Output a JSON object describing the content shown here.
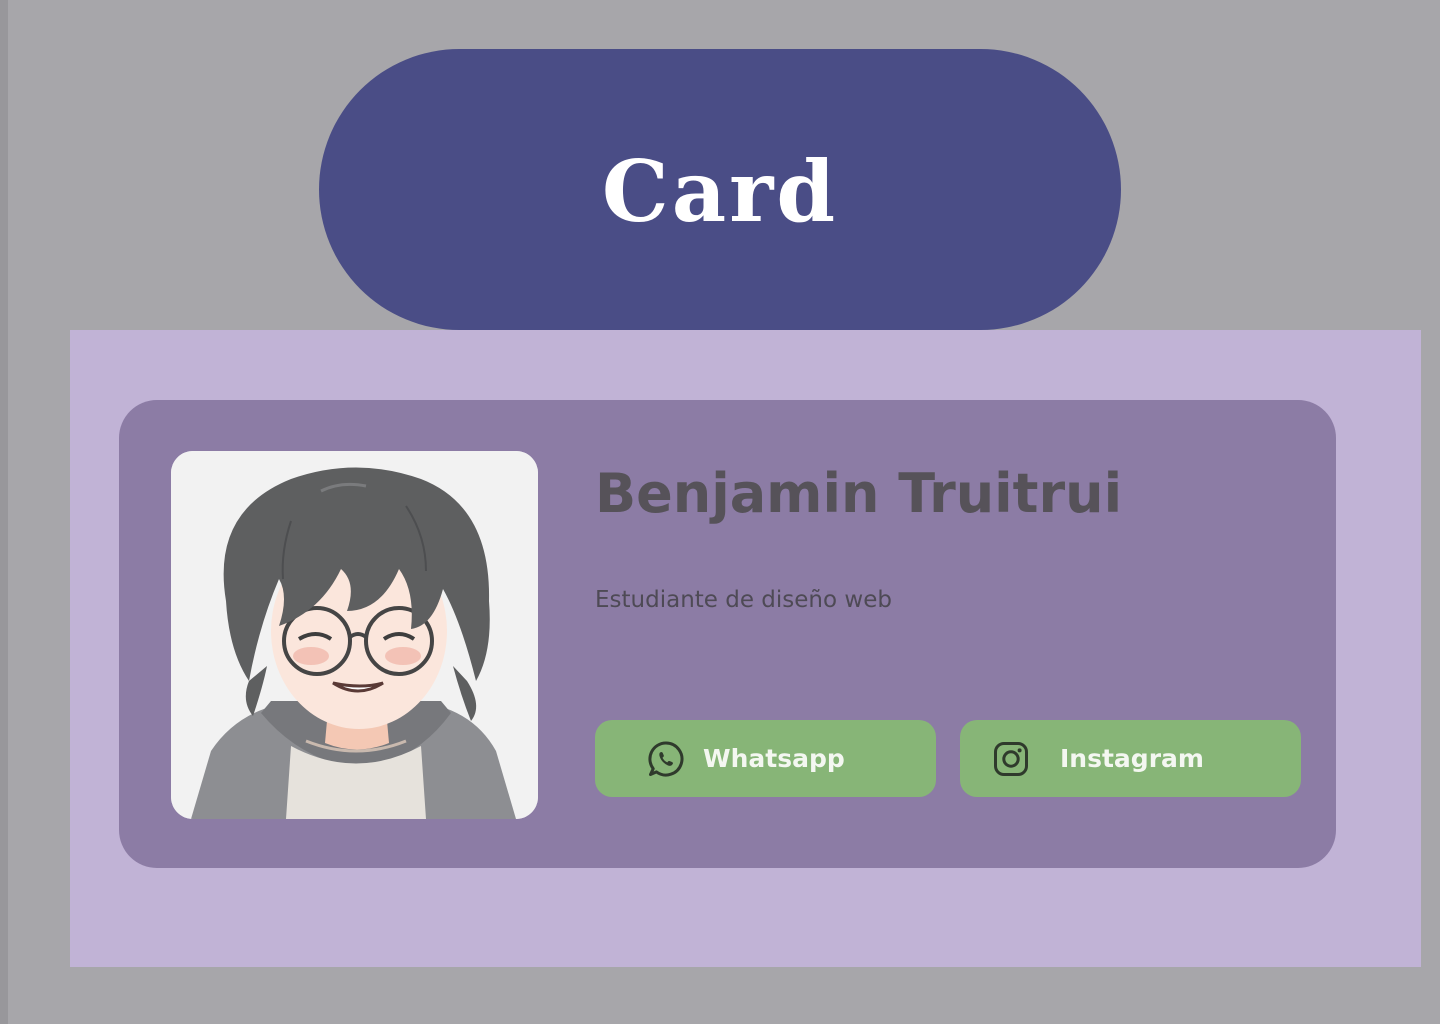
{
  "header": {
    "title": "Card"
  },
  "profile": {
    "name": "Benjamin Truitrui",
    "subtitle": "Estudiante de diseño web",
    "avatar_alt": "Anime-style portrait of a person with dark hair and round glasses"
  },
  "buttons": [
    {
      "label": "Whatsapp",
      "icon": "whatsapp-icon"
    },
    {
      "label": "Instagram",
      "icon": "instagram-icon"
    }
  ],
  "colors": {
    "page_background": "#a7a6aa",
    "title_pill": "#4a4d86",
    "stage_background": "#c1b3d6",
    "card_background": "#8c7ca5",
    "button_background": "#87b577",
    "button_text": "#f4f7f1",
    "name_text": "#565259"
  }
}
